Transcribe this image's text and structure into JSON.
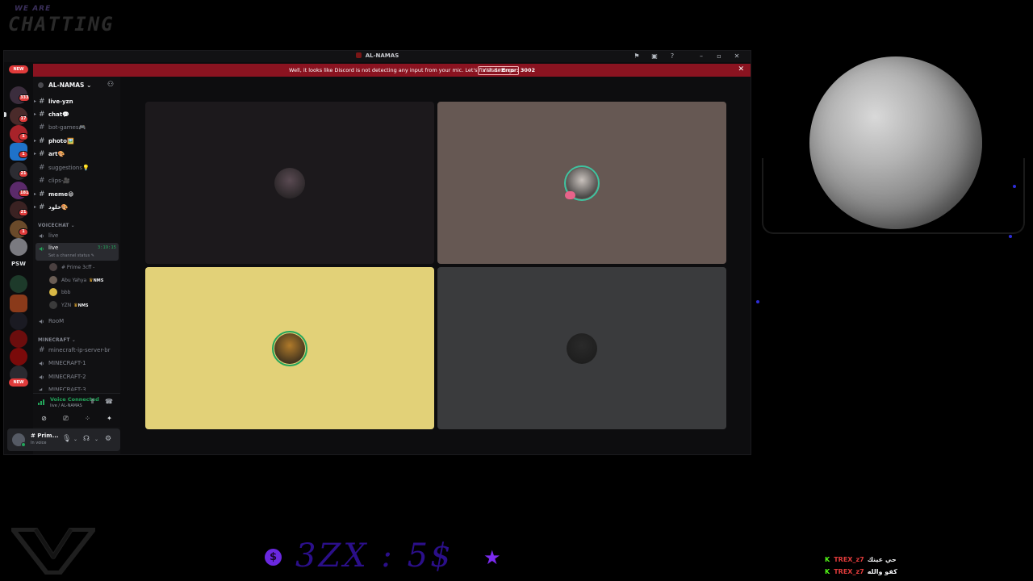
{
  "overlay": {
    "logo_small": "WE ARE",
    "logo_big": "CHATTING",
    "donation_text": "3ZX : 5$",
    "coin_symbol": "$",
    "star_symbol": "★",
    "colors": {
      "accent": "#6a28e0",
      "kick_green": "#53fc18"
    }
  },
  "window": {
    "title": "AL-NAMAS",
    "controls": [
      "flag-icon",
      "inbox-icon",
      "help-icon",
      "minimize-icon",
      "maximize-icon",
      "close-icon"
    ],
    "control_glyphs": [
      "⚑",
      "▣",
      "?",
      "–",
      "▫",
      "✕"
    ]
  },
  "banner": {
    "message_plain": "Well, it looks like Discord is not detecting any input from your mic. Let's fix that!",
    "error_code": "Error: 3002",
    "button_label": "Visit Settings",
    "close_glyph": "✕"
  },
  "rail": {
    "new_pill": "NEW",
    "badges": [
      "333",
      "17",
      "1",
      "1",
      "21",
      "181",
      "21",
      "1"
    ],
    "psw_label": "PSW"
  },
  "server": {
    "name": "AL-NAMAS",
    "chevron": "⌄",
    "text_channels": [
      {
        "label": "live-yzn",
        "unread": true
      },
      {
        "label": "chat💬",
        "unread": true
      },
      {
        "label": "bot-games🎮",
        "unread": false
      },
      {
        "label": "photo🖼️",
        "unread": true
      },
      {
        "label": "art🎨",
        "unread": true
      },
      {
        "label": "suggestions💡",
        "unread": false
      },
      {
        "label": "clips-🎥",
        "unread": false
      },
      {
        "label": "meme😁",
        "unread": true
      },
      {
        "label": "خلود🎨",
        "unread": true
      }
    ],
    "voice_category": "VOICECHAT",
    "voice_channels": {
      "live_idle": "live",
      "live_active": "live",
      "timer": "3:19:15",
      "status": "Set a channel status ✎",
      "room": "RooM"
    },
    "voice_users": [
      {
        "name": "# Prime 3cff -",
        "tag": ""
      },
      {
        "name": "Abu Yahya",
        "tag": "NMS"
      },
      {
        "name": "bbb",
        "tag": ""
      },
      {
        "name": "YZN",
        "tag": "NMS"
      }
    ],
    "minecraft_category": "MINECRAFT",
    "minecraft_channels": [
      "minecraft-ip-server-br",
      "MINECRAFT-1",
      "MINECRAFT-2",
      "MINECRAFT-3"
    ]
  },
  "voice_panel": {
    "status": "Voice Connected",
    "location": "live / AL-NAMAS",
    "buttons": [
      "camera-off",
      "screen-share",
      "activities",
      "soundboard"
    ],
    "button_glyphs": [
      "⊘",
      "⎚",
      "⁘",
      "✦"
    ]
  },
  "user": {
    "name": "# Prim...",
    "status": "In voice"
  },
  "tiles": [
    {
      "bg": "#1c191c",
      "avatar": "#5a4a52",
      "speaking": false
    },
    {
      "bg": "#665853",
      "avatar": "#c9c2bd",
      "speaking": true,
      "muted": true
    },
    {
      "bg": "#e2d178",
      "avatar": "#b07a2a",
      "speaking": true
    },
    {
      "bg": "#3a3b3d",
      "avatar": "#2a2a2a",
      "speaking": false
    }
  ],
  "chat": [
    {
      "user": "TREX_z7",
      "message": "حي عينك"
    },
    {
      "user": "TREX_z7",
      "message": "كفو والله"
    }
  ]
}
